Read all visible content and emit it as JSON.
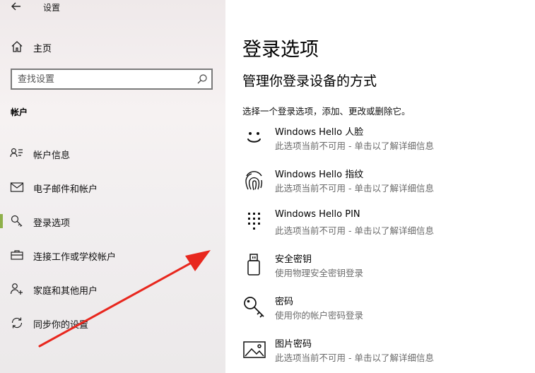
{
  "window": {
    "title": "设置"
  },
  "sidebar": {
    "home_label": "主页",
    "search_placeholder": "查找设置",
    "section_title": "帐户",
    "items": [
      {
        "label": "帐户信息",
        "icon": "account-info-icon"
      },
      {
        "label": "电子邮件和帐户",
        "icon": "mail-icon"
      },
      {
        "label": "登录选项",
        "icon": "key-icon",
        "selected": true
      },
      {
        "label": "连接工作或学校帐户",
        "icon": "briefcase-icon"
      },
      {
        "label": "家庭和其他用户",
        "icon": "add-person-icon"
      },
      {
        "label": "同步你的设置",
        "icon": "sync-icon"
      }
    ]
  },
  "main": {
    "title": "登录选项",
    "subtitle": "管理你登录设备的方式",
    "intro": "选择一个登录选项，添加、更改或删除它。",
    "options": [
      {
        "title": "Windows Hello 人脸",
        "desc": "此选项当前不可用 - 单击以了解详细信息",
        "icon": "face-icon"
      },
      {
        "title": "Windows Hello 指纹",
        "desc": "此选项当前不可用 - 单击以了解详细信息",
        "icon": "fingerprint-icon"
      },
      {
        "title": "Windows Hello PIN",
        "desc": "此选项当前不可用 - 单击以了解详细信息",
        "icon": "pin-keypad-icon"
      },
      {
        "title": "安全密钥",
        "desc": "使用物理安全密钥登录",
        "icon": "usb-key-icon"
      },
      {
        "title": "密码",
        "desc": "使用你的帐户密码登录",
        "icon": "key-icon"
      },
      {
        "title": "图片密码",
        "desc": "此选项当前不可用 - 单击以了解详细信息",
        "icon": "picture-icon"
      }
    ]
  },
  "colors": {
    "accent_selected": "#8fb04a",
    "annotation_arrow": "#e8271e",
    "secondary_text": "#6b6b6b"
  }
}
